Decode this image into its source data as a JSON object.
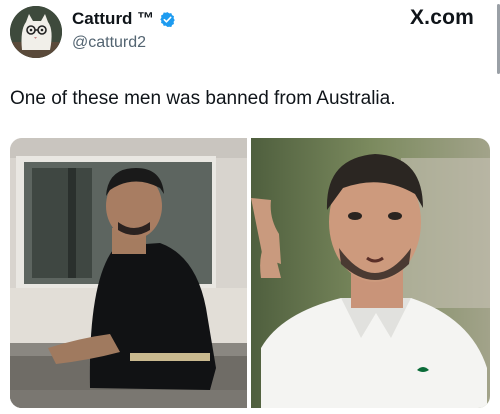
{
  "author": {
    "display_name": "Catturd ™",
    "handle": "@catturd2"
  },
  "brand": "X.com",
  "tweet": {
    "text": "One of these men was banned from Australia."
  },
  "media": {
    "count": 2
  },
  "icons": {
    "verified": "verified-check-icon",
    "brand_logo": "x-logo-icon"
  },
  "colors": {
    "verified_blue": "#1d9bf0",
    "text_primary": "#0f1419",
    "text_secondary": "#536471"
  }
}
